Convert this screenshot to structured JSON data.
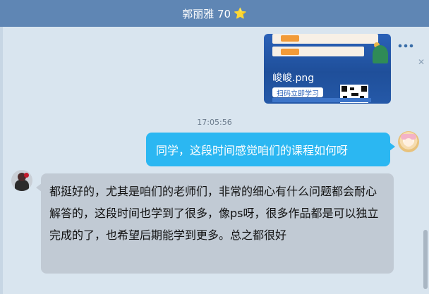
{
  "window": {
    "title": "郭丽雅 70",
    "title_star": "⭐"
  },
  "toolbar": {
    "call_icon": "phone-icon",
    "video_icon": "video-camera-icon",
    "more_icon": "more-dots-icon"
  },
  "messages": [
    {
      "type": "image",
      "direction": "incoming",
      "filename": "峻峻.png",
      "image_button": "扫码立即学习"
    },
    {
      "type": "timestamp",
      "text": "17:05:56"
    },
    {
      "type": "text",
      "direction": "outgoing",
      "text": "同学，这段时间感觉咱们的课程如何呀"
    },
    {
      "type": "text",
      "direction": "incoming",
      "text": "都挺好的，尤其是咱们的老师们，非常的细心有什么问题都会耐心解答的，这段时间也学到了很多，像ps呀，很多作品都是可以独立完成的了，也希望后期能学到更多。总之都很好"
    }
  ],
  "colors": {
    "titlebar": "#5f86b4",
    "chat_background": "#d9e5ef",
    "outgoing_bubble": "#2bb7f2",
    "incoming_bubble": "#c1cad4",
    "icon_accent": "#3a6ea8"
  }
}
